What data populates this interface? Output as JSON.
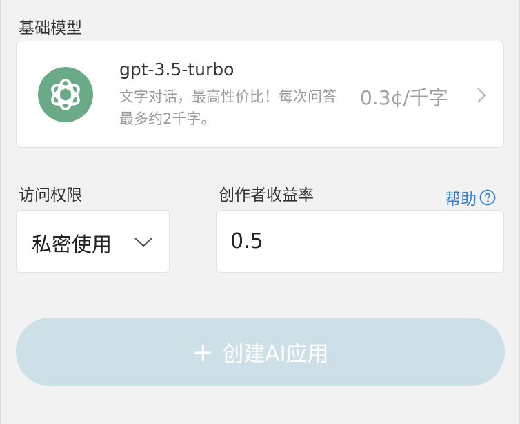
{
  "base_model": {
    "section_label": "基础模型",
    "card": {
      "logo_icon": "openai-logo-icon",
      "name": "gpt-3.5-turbo",
      "description": "文字对话，最高性价比！每次问答最多约2千字。",
      "price": "0.3¢/千字",
      "chevron_icon": "chevron-right-icon"
    }
  },
  "access": {
    "label": "访问权限",
    "selected": "私密使用",
    "chevron_icon": "chevron-down-icon"
  },
  "revenue": {
    "label": "创作者收益率",
    "value": "0.5",
    "help_label": "帮助",
    "help_icon": "question-circle-icon"
  },
  "create_button": {
    "plus_icon": "+",
    "label": "创建AI应用",
    "state": "disabled"
  },
  "colors": {
    "background": "#f2f2f2",
    "logo_green": "#6aaa86",
    "link_blue": "#2f7fd8",
    "button_disabled": "#cde0e8"
  }
}
